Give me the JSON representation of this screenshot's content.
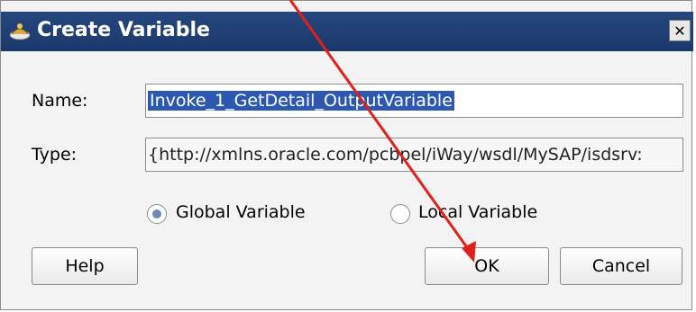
{
  "window": {
    "title": "Create Variable",
    "close_glyph": "✕"
  },
  "form": {
    "name_label": "Name:",
    "name_value": "Invoke_1_GetDetail_OutputVariable",
    "type_label": "Type:",
    "type_value": "{http://xmlns.oracle.com/pcbpel/iWay/wsdl/MySAP/isdsrv:"
  },
  "scope": {
    "global_label": "Global Variable",
    "local_label": "Local Variable",
    "selected": "global"
  },
  "buttons": {
    "help": "Help",
    "ok": "OK",
    "cancel": "Cancel"
  },
  "colors": {
    "titlebar": "#1f3f74",
    "selection": "#2c58b0",
    "arrow": "#e0201b"
  },
  "icons": {
    "title": "variable-icon",
    "annotation": "red-arrow-pointer"
  }
}
